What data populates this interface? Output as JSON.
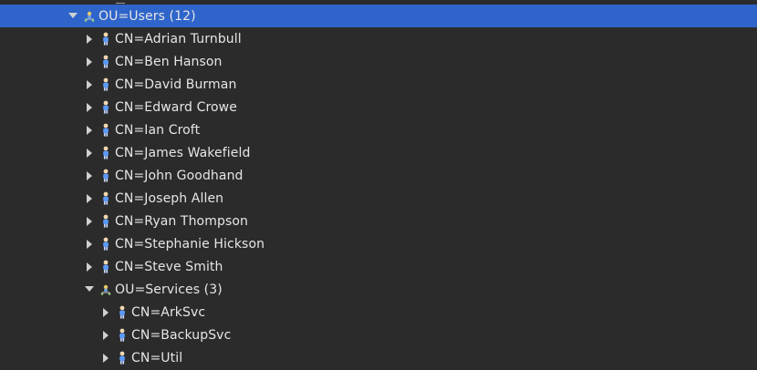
{
  "tree": {
    "users_ou": {
      "label": "OU=Users (12)",
      "expanded": true,
      "selected": true,
      "icon": "ou-icon"
    },
    "user_nodes": [
      {
        "label": "CN=Adrian Turnbull",
        "icon": "user-icon"
      },
      {
        "label": "CN=Ben Hanson",
        "icon": "user-icon"
      },
      {
        "label": "CN=David Burman",
        "icon": "user-icon"
      },
      {
        "label": "CN=Edward Crowe",
        "icon": "user-icon"
      },
      {
        "label": "CN=Ian Croft",
        "icon": "user-icon"
      },
      {
        "label": "CN=James Wakefield",
        "icon": "user-icon"
      },
      {
        "label": "CN=John Goodhand",
        "icon": "user-icon"
      },
      {
        "label": "CN=Joseph Allen",
        "icon": "user-icon"
      },
      {
        "label": "CN=Ryan Thompson",
        "icon": "user-icon"
      },
      {
        "label": "CN=Stephanie Hickson",
        "icon": "user-icon"
      },
      {
        "label": "CN=Steve Smith",
        "icon": "user-icon"
      }
    ],
    "services_ou": {
      "label": "OU=Services (3)",
      "expanded": true,
      "icon": "ou-icon"
    },
    "service_nodes": [
      {
        "label": "CN=ArkSvc",
        "icon": "user-icon"
      },
      {
        "label": "CN=BackupSvc",
        "icon": "user-icon"
      },
      {
        "label": "CN=Util",
        "icon": "user-icon"
      }
    ]
  },
  "colors": {
    "background": "#2b2b2b",
    "selection": "#2f65ca",
    "text": "#e6e6e6",
    "arrow": "#d0d0d0"
  }
}
